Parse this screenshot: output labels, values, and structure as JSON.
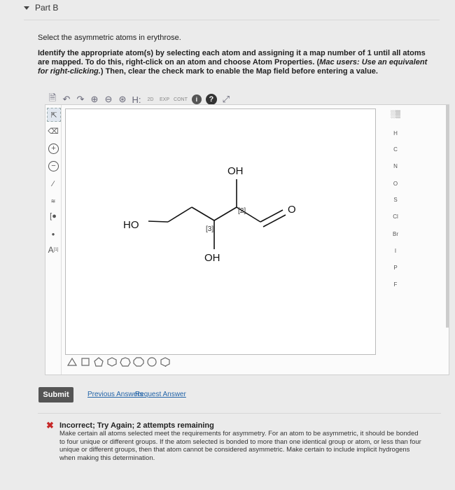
{
  "header": {
    "part_label": "Part B"
  },
  "question": {
    "line1": "Select the asymmetric atoms in erythrose.",
    "instructions_main": "Identify the appropriate atom(s) by selecting each atom and assigning it a map number of 1 until all atoms are mapped. To do this, right-click on an atom and choose Atom Properties. (",
    "instructions_mac": "Mac users: Use an equivalent for right-clicking.",
    "instructions_end": ") Then, clear the check mark to enable the Map field before entering a value."
  },
  "toolbar": {
    "icons": [
      "new-document",
      "undo",
      "redo",
      "zoom-in",
      "zoom-out",
      "zoom-fit",
      "hydrogen-toggle",
      "2d-clean",
      "explicit",
      "cont",
      "info",
      "help",
      "expand"
    ],
    "h_label": "H:",
    "twod_label": "2D",
    "exp_label": "EXP",
    "cont_label": "CONT",
    "info_label": "i",
    "help_label": "?"
  },
  "left_tools": {
    "charge_plus": "+",
    "charge_minus": "−",
    "atom_label": "A",
    "atom_sup": "[1]"
  },
  "molecule": {
    "ho": "HO",
    "oh_top": "OH",
    "oh_bottom": "OH",
    "o": "O",
    "map2": "[2]",
    "map3": "[3]"
  },
  "elements": [
    "H",
    "C",
    "N",
    "O",
    "S",
    "Cl",
    "Br",
    "I",
    "P",
    "F"
  ],
  "periodic_icon": "periodic-table",
  "shapes": [
    "triangle",
    "square",
    "pentagon",
    "hexagon",
    "heptagon",
    "octagon",
    "nonagon",
    "benzene"
  ],
  "actions": {
    "submit": "Submit",
    "previous_answers": "Previous Answers",
    "request_answer": "Request Answer"
  },
  "feedback": {
    "status_color": "#c62828",
    "title": "Incorrect; Try Again; 2 attempts remaining",
    "body": "Make certain all atoms selected meet the requirements for asymmetry. For an atom to be asymmetric, it should be bonded to four unique or different groups. If the atom selected is bonded to more than one identical group or atom, or less than four unique or different groups, then that atom cannot be considered asymmetric. Make certain to include implicit hydrogens when making this determination."
  }
}
